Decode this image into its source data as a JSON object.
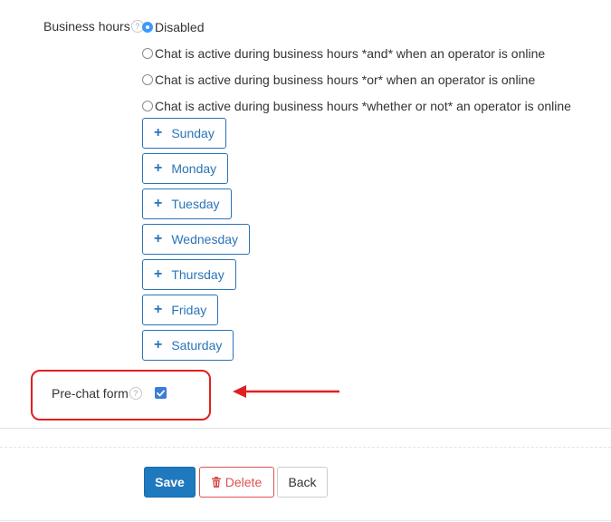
{
  "business_hours": {
    "label": "Business hours",
    "help": "?",
    "options": [
      {
        "label": "Disabled",
        "selected": true
      },
      {
        "label": "Chat is active during business hours *and* when an operator is online",
        "selected": false
      },
      {
        "label": "Chat is active during business hours *or* when an operator is online",
        "selected": false
      },
      {
        "label": "Chat is active during business hours *whether or not* an operator is online",
        "selected": false
      }
    ],
    "days": [
      "Sunday",
      "Monday",
      "Tuesday",
      "Wednesday",
      "Thursday",
      "Friday",
      "Saturday"
    ],
    "add_symbol": "+"
  },
  "prechat": {
    "label": "Pre-chat form",
    "help": "?",
    "checked": true
  },
  "actions": {
    "save": "Save",
    "delete": "Delete",
    "back": "Back"
  },
  "colors": {
    "primary": "#1f79be",
    "danger": "#d9534f",
    "highlight": "#e02020",
    "link": "#2a74b8"
  }
}
